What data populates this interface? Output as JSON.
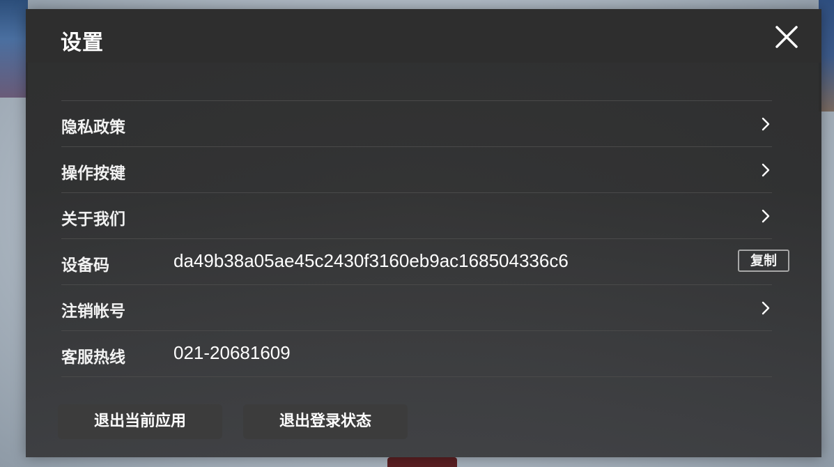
{
  "dialog": {
    "title": "设置",
    "close_icon": "close-icon"
  },
  "menu": {
    "privacy_policy": {
      "label": "隐私政策",
      "icon": "chevron-right-icon"
    },
    "controls": {
      "label": "操作按键",
      "icon": "chevron-right-icon"
    },
    "about_us": {
      "label": "关于我们",
      "icon": "chevron-right-icon"
    },
    "device_code": {
      "label": "设备码",
      "value": "da49b38a05ae45c2430f3160eb9ac168504336c6",
      "copy_label": "复制"
    },
    "delete_account": {
      "label": "注销帐号",
      "icon": "chevron-right-icon"
    },
    "hotline": {
      "label": "客服热线",
      "value": "021-20681609"
    }
  },
  "footer": {
    "exit_app_label": "退出当前应用",
    "logout_label": "退出登录状态"
  },
  "colors": {
    "dialog_bg": "#2a2a2a",
    "header_bg": "#2e2e2e",
    "text": "#ffffff",
    "divider": "#4a4a4a",
    "button_bg": "#3c3c3c"
  }
}
